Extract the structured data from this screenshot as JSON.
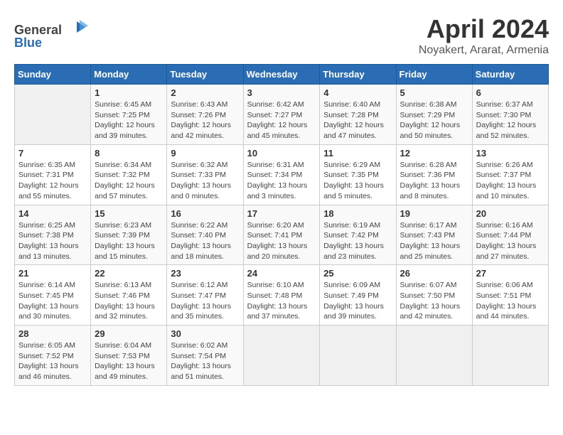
{
  "header": {
    "logo_general": "General",
    "logo_blue": "Blue",
    "title": "April 2024",
    "subtitle": "Noyakert, Ararat, Armenia"
  },
  "weekdays": [
    "Sunday",
    "Monday",
    "Tuesday",
    "Wednesday",
    "Thursday",
    "Friday",
    "Saturday"
  ],
  "weeks": [
    [
      {
        "day": "",
        "info": ""
      },
      {
        "day": "1",
        "info": "Sunrise: 6:45 AM\nSunset: 7:25 PM\nDaylight: 12 hours\nand 39 minutes."
      },
      {
        "day": "2",
        "info": "Sunrise: 6:43 AM\nSunset: 7:26 PM\nDaylight: 12 hours\nand 42 minutes."
      },
      {
        "day": "3",
        "info": "Sunrise: 6:42 AM\nSunset: 7:27 PM\nDaylight: 12 hours\nand 45 minutes."
      },
      {
        "day": "4",
        "info": "Sunrise: 6:40 AM\nSunset: 7:28 PM\nDaylight: 12 hours\nand 47 minutes."
      },
      {
        "day": "5",
        "info": "Sunrise: 6:38 AM\nSunset: 7:29 PM\nDaylight: 12 hours\nand 50 minutes."
      },
      {
        "day": "6",
        "info": "Sunrise: 6:37 AM\nSunset: 7:30 PM\nDaylight: 12 hours\nand 52 minutes."
      }
    ],
    [
      {
        "day": "7",
        "info": "Sunrise: 6:35 AM\nSunset: 7:31 PM\nDaylight: 12 hours\nand 55 minutes."
      },
      {
        "day": "8",
        "info": "Sunrise: 6:34 AM\nSunset: 7:32 PM\nDaylight: 12 hours\nand 57 minutes."
      },
      {
        "day": "9",
        "info": "Sunrise: 6:32 AM\nSunset: 7:33 PM\nDaylight: 13 hours\nand 0 minutes."
      },
      {
        "day": "10",
        "info": "Sunrise: 6:31 AM\nSunset: 7:34 PM\nDaylight: 13 hours\nand 3 minutes."
      },
      {
        "day": "11",
        "info": "Sunrise: 6:29 AM\nSunset: 7:35 PM\nDaylight: 13 hours\nand 5 minutes."
      },
      {
        "day": "12",
        "info": "Sunrise: 6:28 AM\nSunset: 7:36 PM\nDaylight: 13 hours\nand 8 minutes."
      },
      {
        "day": "13",
        "info": "Sunrise: 6:26 AM\nSunset: 7:37 PM\nDaylight: 13 hours\nand 10 minutes."
      }
    ],
    [
      {
        "day": "14",
        "info": "Sunrise: 6:25 AM\nSunset: 7:38 PM\nDaylight: 13 hours\nand 13 minutes."
      },
      {
        "day": "15",
        "info": "Sunrise: 6:23 AM\nSunset: 7:39 PM\nDaylight: 13 hours\nand 15 minutes."
      },
      {
        "day": "16",
        "info": "Sunrise: 6:22 AM\nSunset: 7:40 PM\nDaylight: 13 hours\nand 18 minutes."
      },
      {
        "day": "17",
        "info": "Sunrise: 6:20 AM\nSunset: 7:41 PM\nDaylight: 13 hours\nand 20 minutes."
      },
      {
        "day": "18",
        "info": "Sunrise: 6:19 AM\nSunset: 7:42 PM\nDaylight: 13 hours\nand 23 minutes."
      },
      {
        "day": "19",
        "info": "Sunrise: 6:17 AM\nSunset: 7:43 PM\nDaylight: 13 hours\nand 25 minutes."
      },
      {
        "day": "20",
        "info": "Sunrise: 6:16 AM\nSunset: 7:44 PM\nDaylight: 13 hours\nand 27 minutes."
      }
    ],
    [
      {
        "day": "21",
        "info": "Sunrise: 6:14 AM\nSunset: 7:45 PM\nDaylight: 13 hours\nand 30 minutes."
      },
      {
        "day": "22",
        "info": "Sunrise: 6:13 AM\nSunset: 7:46 PM\nDaylight: 13 hours\nand 32 minutes."
      },
      {
        "day": "23",
        "info": "Sunrise: 6:12 AM\nSunset: 7:47 PM\nDaylight: 13 hours\nand 35 minutes."
      },
      {
        "day": "24",
        "info": "Sunrise: 6:10 AM\nSunset: 7:48 PM\nDaylight: 13 hours\nand 37 minutes."
      },
      {
        "day": "25",
        "info": "Sunrise: 6:09 AM\nSunset: 7:49 PM\nDaylight: 13 hours\nand 39 minutes."
      },
      {
        "day": "26",
        "info": "Sunrise: 6:07 AM\nSunset: 7:50 PM\nDaylight: 13 hours\nand 42 minutes."
      },
      {
        "day": "27",
        "info": "Sunrise: 6:06 AM\nSunset: 7:51 PM\nDaylight: 13 hours\nand 44 minutes."
      }
    ],
    [
      {
        "day": "28",
        "info": "Sunrise: 6:05 AM\nSunset: 7:52 PM\nDaylight: 13 hours\nand 46 minutes."
      },
      {
        "day": "29",
        "info": "Sunrise: 6:04 AM\nSunset: 7:53 PM\nDaylight: 13 hours\nand 49 minutes."
      },
      {
        "day": "30",
        "info": "Sunrise: 6:02 AM\nSunset: 7:54 PM\nDaylight: 13 hours\nand 51 minutes."
      },
      {
        "day": "",
        "info": ""
      },
      {
        "day": "",
        "info": ""
      },
      {
        "day": "",
        "info": ""
      },
      {
        "day": "",
        "info": ""
      }
    ]
  ]
}
